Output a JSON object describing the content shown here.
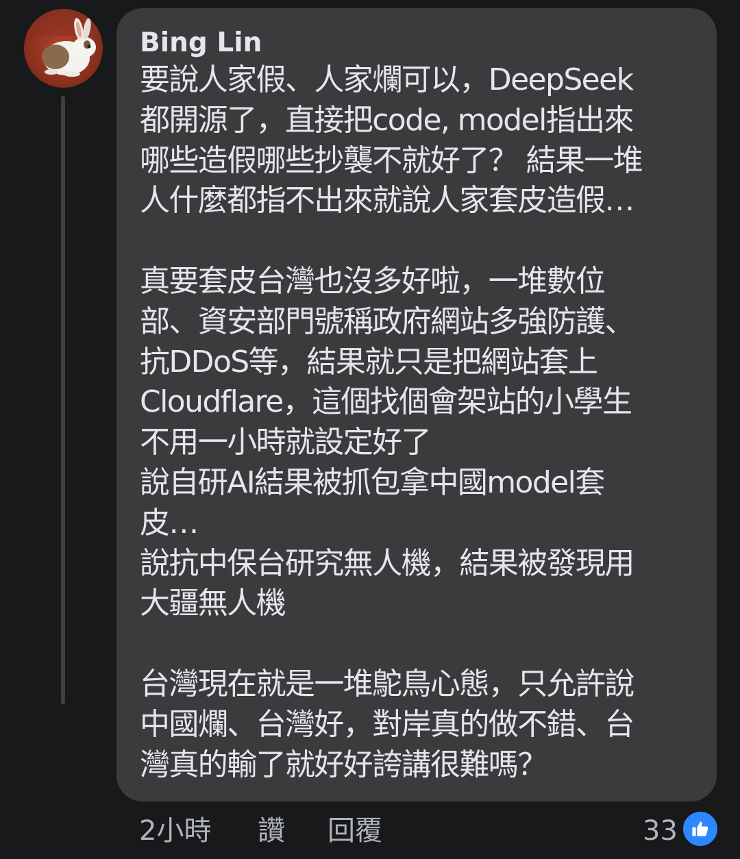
{
  "comment": {
    "author": "Bing Lin",
    "avatar_icon": "rabbit-avatar-icon",
    "paragraphs": [
      "要說人家假、人家爛可以，DeepSeek\n都開源了，直接把code, model指出來\n哪些造假哪些抄襲不就好了？ 結果一堆\n人什麼都指不出來就說人家套皮造假…",
      "真要套皮台灣也沒多好啦，一堆數位\n部、資安部門號稱政府網站多強防護、\n抗DDoS等，結果就只是把網站套上\nCloudflare，這個找個會架站的小學生\n不用一小時就設定好了\n說自研AI結果被抓包拿中國model套\n皮…\n說抗中保台研究無人機，結果被發現用\n大疆無人機",
      "台灣現在就是一堆鴕鳥心態，只允許說\n中國爛、台灣好，對岸真的做不錯、台\n灣真的輸了就好好誇講很難嗎？"
    ]
  },
  "footer": {
    "time": "2小時",
    "like_label": "讚",
    "reply_label": "回覆",
    "reaction_count": "33",
    "reaction_icon": "thumbs-up-icon"
  },
  "colors": {
    "background": "#18191a",
    "bubble": "#3a3b3c",
    "text": "#e4e6eb",
    "secondary_text": "#b0b3b8",
    "like_blue": "#2d88ff"
  }
}
